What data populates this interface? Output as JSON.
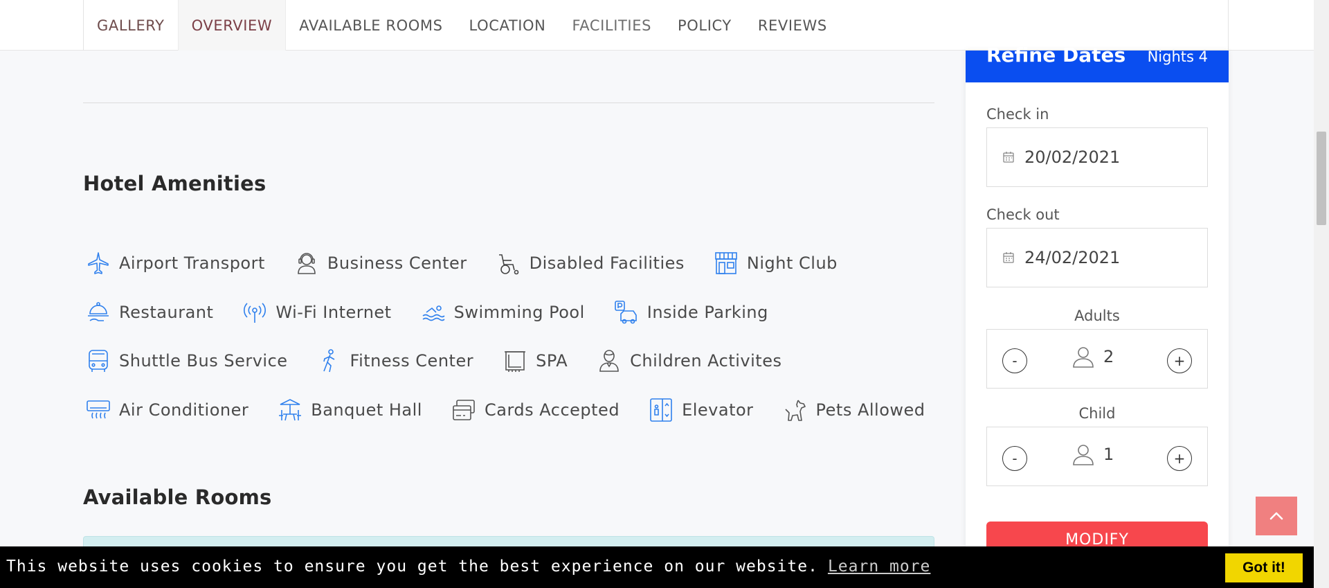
{
  "nav": {
    "tabs": [
      {
        "label": "GALLERY"
      },
      {
        "label": "OVERVIEW"
      },
      {
        "label": "AVAILABLE ROOMS"
      },
      {
        "label": "LOCATION"
      },
      {
        "label": "FACILITIES"
      },
      {
        "label": "POLICY"
      },
      {
        "label": "REVIEWS"
      }
    ]
  },
  "amenities": {
    "title": "Hotel Amenities",
    "items": [
      {
        "label": "Airport Transport",
        "icon": "airplane-icon"
      },
      {
        "label": "Business Center",
        "icon": "headset-person-icon"
      },
      {
        "label": "Disabled Facilities",
        "icon": "wheelchair-icon"
      },
      {
        "label": "Night Club",
        "icon": "storefront-icon"
      },
      {
        "label": "Restaurant",
        "icon": "cloche-icon"
      },
      {
        "label": "Wi-Fi Internet",
        "icon": "antenna-icon"
      },
      {
        "label": "Swimming Pool",
        "icon": "swimmer-icon"
      },
      {
        "label": "Inside Parking",
        "icon": "parking-car-icon"
      },
      {
        "label": "Shuttle Bus Service",
        "icon": "bus-icon"
      },
      {
        "label": "Fitness Center",
        "icon": "running-person-icon"
      },
      {
        "label": "SPA",
        "icon": "towel-icon"
      },
      {
        "label": "Children Activites",
        "icon": "child-icon"
      },
      {
        "label": "Air Conditioner",
        "icon": "air-conditioner-icon"
      },
      {
        "label": "Banquet Hall",
        "icon": "banquet-table-icon"
      },
      {
        "label": "Cards Accepted",
        "icon": "credit-card-icon"
      },
      {
        "label": "Elevator",
        "icon": "elevator-icon"
      },
      {
        "label": "Pets Allowed",
        "icon": "dog-icon"
      }
    ]
  },
  "rooms": {
    "title": "Available Rooms"
  },
  "refine": {
    "title": "Refine Dates",
    "nights": "Nights 4",
    "check_in_label": "Check in",
    "check_in_value": "20/02/2021",
    "check_out_label": "Check out",
    "check_out_value": "24/02/2021",
    "adults_label": "Adults",
    "adults_value": "2",
    "child_label": "Child",
    "child_value": "1",
    "minus": "-",
    "plus": "+",
    "modify_label": "MODIFY"
  },
  "cookie": {
    "message": "This website uses cookies to ensure you get the best experience on our website.",
    "learn_more": "Learn more",
    "accept": "Got it!"
  },
  "colors": {
    "accent_blue": "#0a4ef0",
    "modify_red": "#f7474d",
    "icon_blue": "#2f80ed",
    "cookie_yellow": "#f1d600"
  }
}
